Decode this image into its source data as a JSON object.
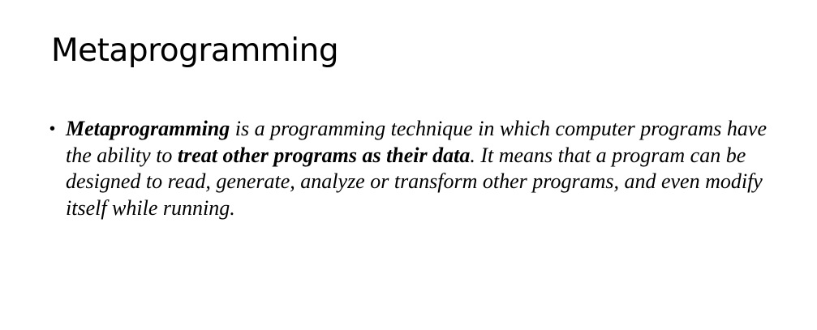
{
  "slide": {
    "title": "Metaprogramming",
    "bullet_symbol": "•",
    "bullet": {
      "term": "Metaprogramming",
      "text_1": " is a programming technique in which computer programs have the ability to ",
      "emphasis": "treat other programs as their data",
      "text_2": ". It means that a program can be designed to read, generate, analyze or transform other programs, and even modify itself while running."
    }
  }
}
